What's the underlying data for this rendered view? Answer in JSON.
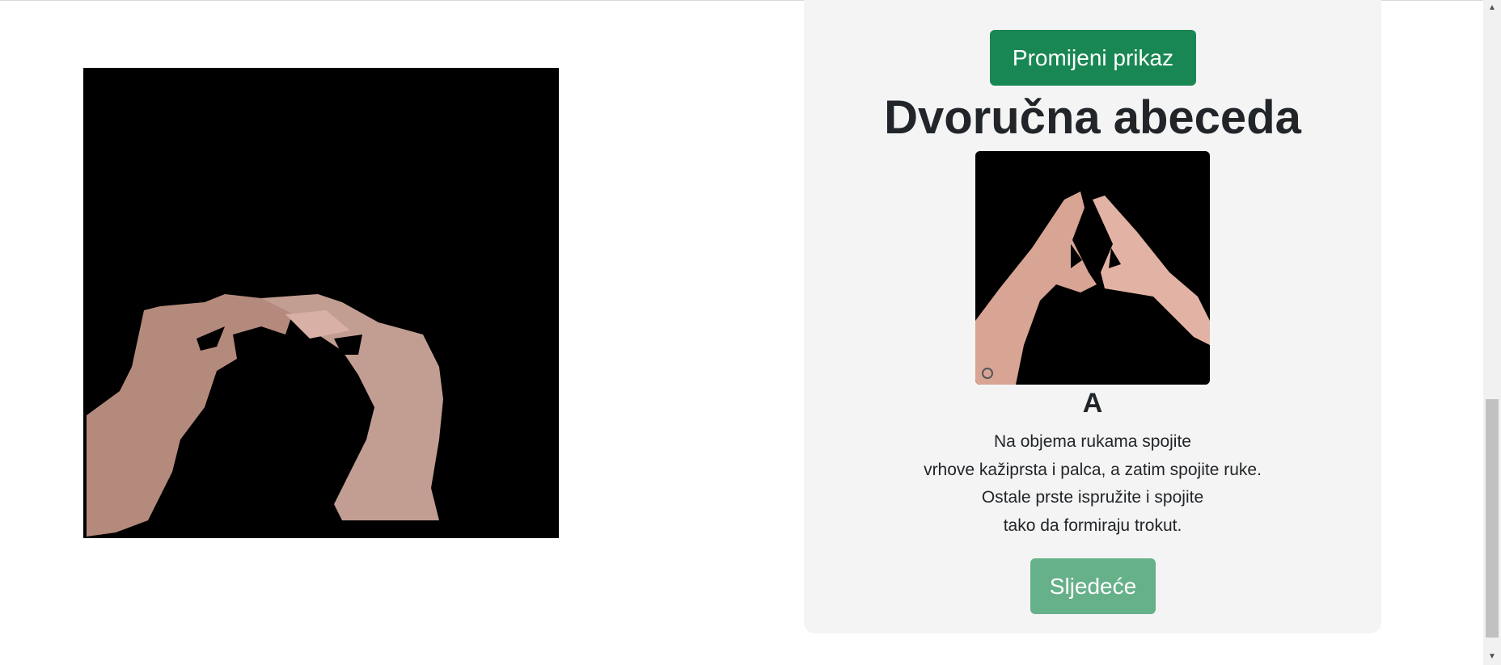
{
  "webcam": {
    "label": "webcam-feed"
  },
  "panel": {
    "change_view_label": "Promijeni prikaz",
    "title": "Dvoručna abeceda",
    "letter": "A",
    "description": [
      "Na objema rukama spojite",
      "vrhove kažiprsta i palca, a zatim spojite ruke.",
      "Ostale prste ispružite i spojite",
      "tako da formiraju trokut."
    ],
    "next_label": "Sljedeće"
  },
  "colors": {
    "primary_button": "#198754",
    "next_button": "#66b08a",
    "panel_bg": "#f4f4f4"
  },
  "scrollbar": {
    "up_icon": "chevron-up-icon",
    "down_icon": "chevron-down-icon"
  }
}
